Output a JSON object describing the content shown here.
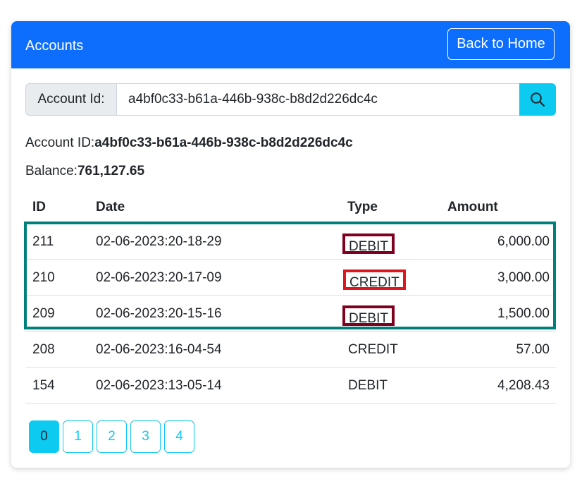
{
  "header": {
    "title": "Accounts",
    "back_label": "Back to Home"
  },
  "search": {
    "label": "Account Id:",
    "value": "a4bf0c33-b61a-446b-938c-b8d2d226dc4c",
    "icon": "search-icon"
  },
  "account": {
    "id_label": "Account ID:",
    "id_value": "a4bf0c33-b61a-446b-938c-b8d2d226dc4c",
    "balance_label": "Balance:",
    "balance_value": "761,127.65"
  },
  "table": {
    "columns": [
      "ID",
      "Date",
      "Type",
      "Amount"
    ],
    "rows": [
      {
        "id": "211",
        "date": "02-06-2023:20-18-29",
        "type": "DEBIT",
        "amount": "6,000.00"
      },
      {
        "id": "210",
        "date": "02-06-2023:20-17-09",
        "type": "CREDIT",
        "amount": "3,000.00"
      },
      {
        "id": "209",
        "date": "02-06-2023:20-15-16",
        "type": "DEBIT",
        "amount": "1,500.00"
      },
      {
        "id": "208",
        "date": "02-06-2023:16-04-54",
        "type": "CREDIT",
        "amount": "57.00"
      },
      {
        "id": "154",
        "date": "02-06-2023:13-05-14",
        "type": "DEBIT",
        "amount": "4,208.43"
      }
    ]
  },
  "pagination": {
    "pages": [
      "0",
      "1",
      "2",
      "3",
      "4"
    ],
    "active": "0"
  },
  "colors": {
    "primary": "#0d6efd",
    "info": "#0dcaf0",
    "highlight_group": "#00807c",
    "debit_box": "#800020",
    "credit_box": "#e0161f"
  }
}
